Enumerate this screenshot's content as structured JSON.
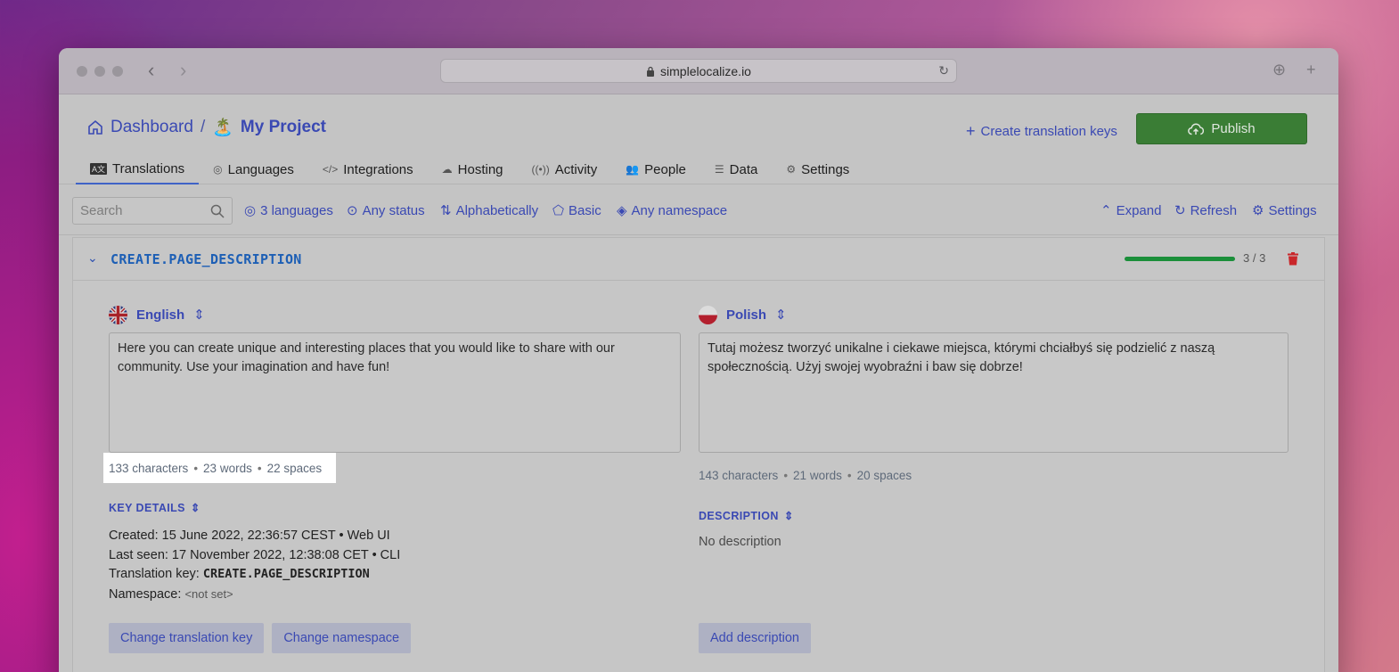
{
  "browser": {
    "url": "simplelocalize.io"
  },
  "header": {
    "dashboard": "Dashboard",
    "separator": "/",
    "project_emoji": "🏝️",
    "project": "My Project",
    "create_keys": "Create translation keys",
    "publish": "Publish"
  },
  "tabs": [
    {
      "label": "Translations",
      "icon": "translations-icon"
    },
    {
      "label": "Languages",
      "icon": "globe-icon"
    },
    {
      "label": "Integrations",
      "icon": "code-icon"
    },
    {
      "label": "Hosting",
      "icon": "cloud-icon"
    },
    {
      "label": "Activity",
      "icon": "activity-icon"
    },
    {
      "label": "People",
      "icon": "people-icon"
    },
    {
      "label": "Data",
      "icon": "database-icon"
    },
    {
      "label": "Settings",
      "icon": "gear-icon"
    }
  ],
  "filters": {
    "search_placeholder": "Search",
    "languages": "3 languages",
    "status": "Any status",
    "sort": "Alphabetically",
    "view": "Basic",
    "namespace": "Any namespace",
    "expand": "Expand",
    "refresh": "Refresh",
    "settings": "Settings"
  },
  "key": {
    "name": "CREATE.PAGE_DESCRIPTION",
    "progress": "3 / 3",
    "progress_fraction": 1.0
  },
  "english": {
    "language": "English",
    "text": "Here you can create unique and interesting places that you would like to share with our community. Use your imagination and have fun!",
    "characters": "133 characters",
    "words": "23 words",
    "spaces": "22 spaces"
  },
  "polish": {
    "language": "Polish",
    "text": "Tutaj możesz tworzyć unikalne i ciekawe miejsca, którymi chciałbyś się podzielić z naszą społecznością. Użyj swojej wyobraźni i baw się dobrze!",
    "characters": "143 characters",
    "words": "21 words",
    "spaces": "20 spaces"
  },
  "details": {
    "label": "KEY DETAILS",
    "created": "Created: 15 June 2022, 22:36:57 CEST",
    "created_source": "Web UI",
    "last_seen": "Last seen: 17 November 2022, 12:38:08 CET",
    "last_seen_source": "CLI",
    "translation_key_label": "Translation key:",
    "translation_key": "CREATE.PAGE_DESCRIPTION",
    "namespace_label": "Namespace:",
    "namespace": "<not set>",
    "change_key": "Change translation key",
    "change_namespace": "Change namespace"
  },
  "description": {
    "label": "DESCRIPTION",
    "text": "No description",
    "add": "Add description"
  }
}
